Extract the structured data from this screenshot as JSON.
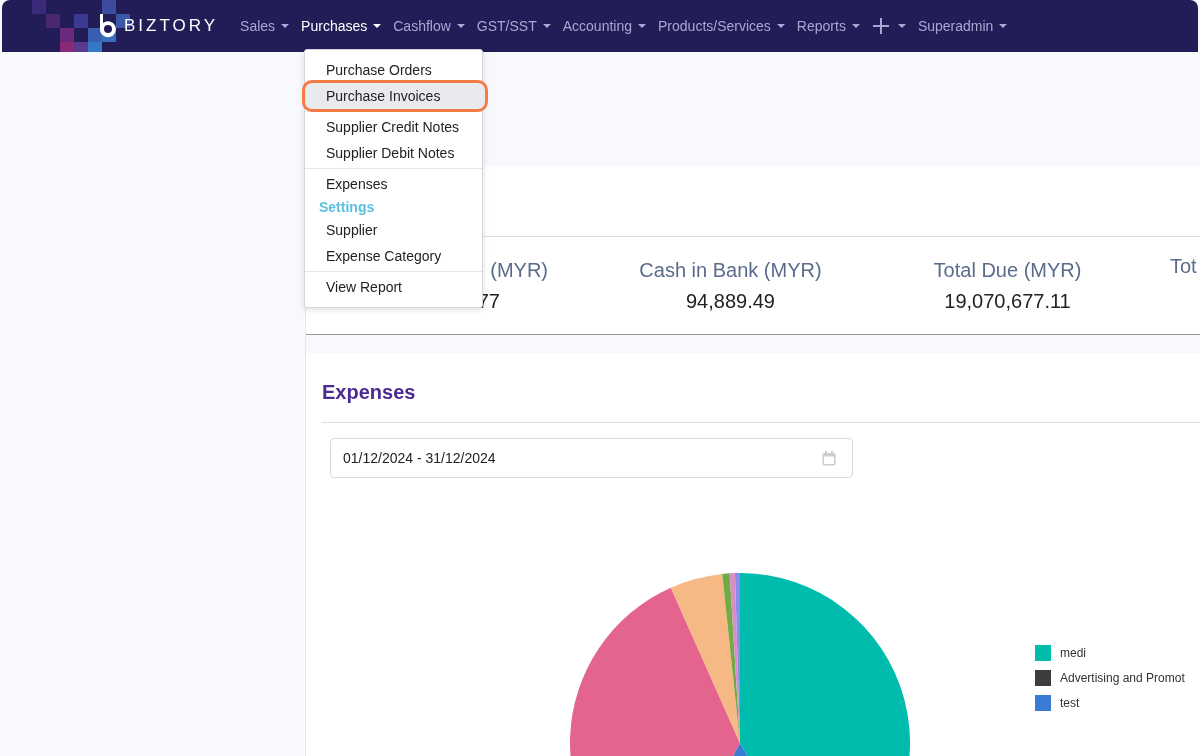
{
  "brand": "BIZTORY",
  "nav": [
    {
      "label": "Sales",
      "kind": "text",
      "selected": false
    },
    {
      "label": "Purchases",
      "kind": "text",
      "selected": true
    },
    {
      "label": "Cashflow",
      "kind": "text",
      "selected": false
    },
    {
      "label": "GST/SST",
      "kind": "text",
      "selected": false
    },
    {
      "label": "Accounting",
      "kind": "text",
      "selected": false
    },
    {
      "label": "Products/Services",
      "kind": "text",
      "selected": false
    },
    {
      "label": "Reports",
      "kind": "text",
      "selected": false
    },
    {
      "kind": "plus",
      "selected": false
    },
    {
      "label": "Superadmin",
      "kind": "text",
      "selected": false
    }
  ],
  "menu": [
    [
      {
        "kind": "item",
        "label": "Purchase Orders",
        "selected": false
      },
      {
        "kind": "item",
        "label": "Purchase Invoices",
        "selected": true
      }
    ],
    [
      {
        "kind": "item",
        "label": "Supplier Credit Notes",
        "selected": false
      },
      {
        "kind": "item",
        "label": "Supplier Debit Notes",
        "selected": false
      }
    ],
    [
      {
        "kind": "item",
        "label": "Expenses",
        "selected": false
      },
      {
        "kind": "heading",
        "label": "Settings"
      },
      {
        "kind": "item",
        "label": "Supplier",
        "selected": false
      },
      {
        "kind": "item",
        "label": "Expense Category",
        "selected": false
      }
    ],
    [
      {
        "kind": "item",
        "label": "View Report",
        "selected": false
      }
    ]
  ],
  "stats": [
    {
      "label": "(MYR)",
      "value": "77"
    },
    {
      "label": "Cash in Bank (MYR)",
      "value": "94,889.49"
    },
    {
      "label": "Total Due (MYR)",
      "value": "19,070,677.11"
    },
    {
      "label": "Tot"
    }
  ],
  "expenses": {
    "title": "Expenses",
    "date_range": "01/12/2024 - 31/12/2024",
    "legend": [
      {
        "label": "medi",
        "color": "#00bcad"
      },
      {
        "label": "Advertising and Promot",
        "color": "#3d3d3d"
      },
      {
        "label": "test",
        "color": "#3a7bd5"
      }
    ]
  }
}
